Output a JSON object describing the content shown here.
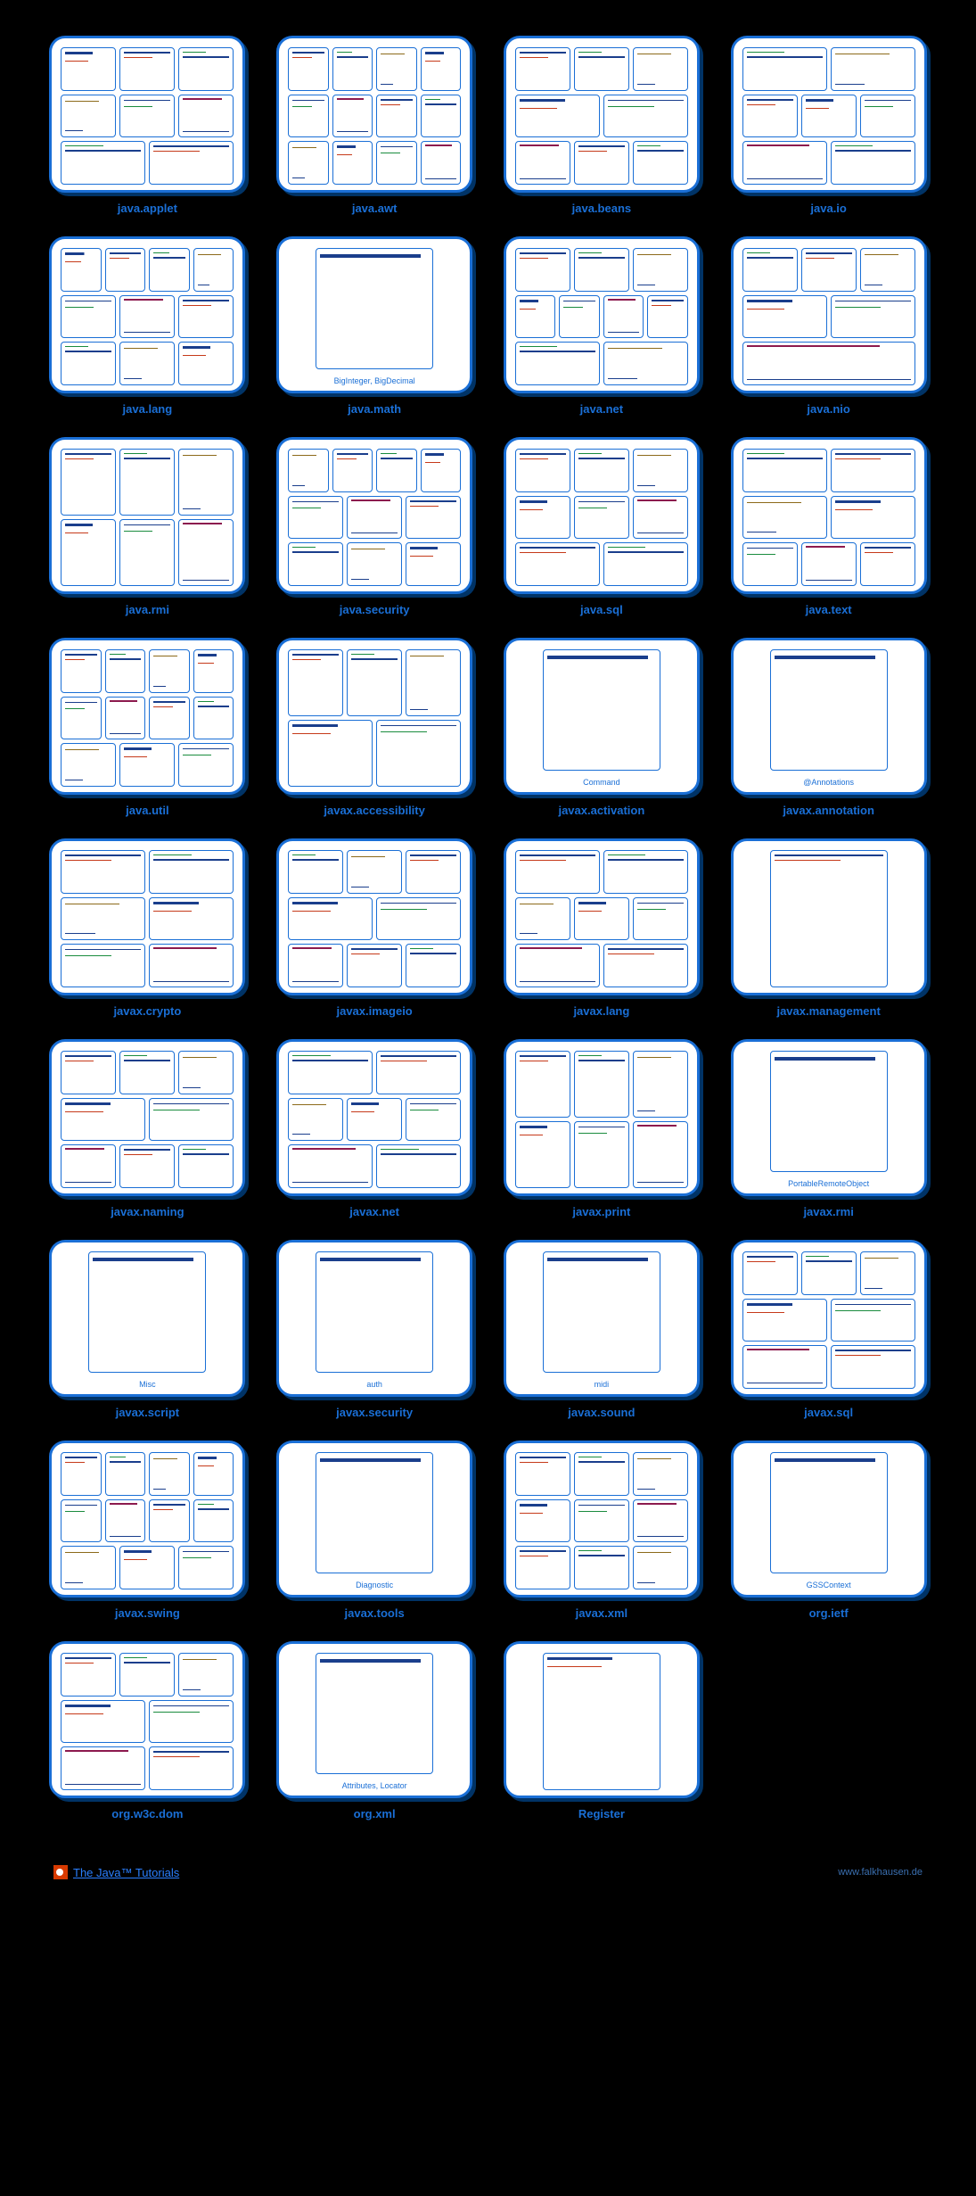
{
  "items": [
    {
      "label": "java.applet",
      "caption": ""
    },
    {
      "label": "java.awt",
      "caption": ""
    },
    {
      "label": "java.beans",
      "caption": ""
    },
    {
      "label": "java.io",
      "caption": ""
    },
    {
      "label": "java.lang",
      "caption": ""
    },
    {
      "label": "java.math",
      "caption": "BigInteger, BigDecimal"
    },
    {
      "label": "java.net",
      "caption": ""
    },
    {
      "label": "java.nio",
      "caption": ""
    },
    {
      "label": "java.rmi",
      "caption": ""
    },
    {
      "label": "java.security",
      "caption": ""
    },
    {
      "label": "java.sql",
      "caption": ""
    },
    {
      "label": "java.text",
      "caption": ""
    },
    {
      "label": "java.util",
      "caption": ""
    },
    {
      "label": "javax.accessibility",
      "caption": ""
    },
    {
      "label": "javax.activation",
      "caption": "Command"
    },
    {
      "label": "javax.annotation",
      "caption": "@Annotations"
    },
    {
      "label": "javax.crypto",
      "caption": ""
    },
    {
      "label": "javax.imageio",
      "caption": ""
    },
    {
      "label": "javax.lang",
      "caption": ""
    },
    {
      "label": "javax.management",
      "caption": ""
    },
    {
      "label": "javax.naming",
      "caption": ""
    },
    {
      "label": "javax.net",
      "caption": ""
    },
    {
      "label": "javax.print",
      "caption": ""
    },
    {
      "label": "javax.rmi",
      "caption": "PortableRemoteObject"
    },
    {
      "label": "javax.script",
      "caption": "Misc"
    },
    {
      "label": "javax.security",
      "caption": "auth"
    },
    {
      "label": "javax.sound",
      "caption": "midi"
    },
    {
      "label": "javax.sql",
      "caption": ""
    },
    {
      "label": "javax.swing",
      "caption": ""
    },
    {
      "label": "javax.tools",
      "caption": "Diagnostic"
    },
    {
      "label": "javax.xml",
      "caption": ""
    },
    {
      "label": "org.ietf",
      "caption": "GSSContext"
    },
    {
      "label": "org.w3c.dom",
      "caption": ""
    },
    {
      "label": "org.xml",
      "caption": "Attributes, Locator"
    },
    {
      "label": "Register",
      "caption": ""
    }
  ],
  "footer": {
    "tutorials": "The Java™ Tutorials",
    "credit": "www.falkhausen.de"
  },
  "layouts": {
    "variants": [
      [
        [
          "s4",
          "s1",
          "s2"
        ],
        [
          "s3",
          "s5",
          "s6"
        ],
        [
          "s2",
          "s1"
        ]
      ],
      [
        [
          "s1",
          "s2",
          "s3",
          "s4"
        ],
        [
          "s5",
          "s6",
          "s1",
          "s2"
        ],
        [
          "s3",
          "s4",
          "s5",
          "s6"
        ]
      ],
      [
        [
          "s1",
          "s2",
          "s3"
        ],
        [
          "s4",
          "s5"
        ],
        [
          "s6",
          "s1",
          "s2"
        ]
      ],
      [
        [
          "s2",
          "s3"
        ],
        [
          "s1",
          "s4",
          "s5"
        ],
        [
          "s6",
          "s2"
        ]
      ],
      [
        [
          "s4",
          "s1",
          "s2",
          "s3"
        ],
        [
          "s5",
          "s6",
          "s1"
        ],
        [
          "s2",
          "s3",
          "s4"
        ]
      ],
      [
        [
          "s7"
        ]
      ],
      [
        [
          "s1",
          "s2",
          "s3"
        ],
        [
          "s4",
          "s5",
          "s6",
          "s1"
        ],
        [
          "s2",
          "s3"
        ]
      ],
      [
        [
          "s2",
          "s1",
          "s3"
        ],
        [
          "s4",
          "s5"
        ],
        [
          "s6"
        ]
      ],
      [
        [
          "s1",
          "s2",
          "s3"
        ],
        [
          "s4",
          "s5",
          "s6"
        ]
      ],
      [
        [
          "s3",
          "s1",
          "s2",
          "s4"
        ],
        [
          "s5",
          "s6",
          "s1"
        ],
        [
          "s2",
          "s3",
          "s4"
        ]
      ],
      [
        [
          "s1",
          "s2",
          "s3"
        ],
        [
          "s4",
          "s5",
          "s6"
        ],
        [
          "s1",
          "s2"
        ]
      ],
      [
        [
          "s2",
          "s1"
        ],
        [
          "s3",
          "s4"
        ],
        [
          "s5",
          "s6",
          "s1"
        ]
      ],
      [
        [
          "s1",
          "s2",
          "s3",
          "s4"
        ],
        [
          "s5",
          "s6",
          "s1",
          "s2"
        ],
        [
          "s3",
          "s4",
          "s5"
        ]
      ],
      [
        [
          "s1",
          "s2",
          "s3"
        ],
        [
          "s4",
          "s5"
        ]
      ],
      [
        [
          "s7"
        ]
      ],
      [
        [
          "s7"
        ]
      ],
      [
        [
          "s1",
          "s2"
        ],
        [
          "s3",
          "s4"
        ],
        [
          "s5",
          "s6"
        ]
      ],
      [
        [
          "s2",
          "s3",
          "s1"
        ],
        [
          "s4",
          "s5"
        ],
        [
          "s6",
          "s1",
          "s2"
        ]
      ],
      [
        [
          "s1",
          "s2"
        ],
        [
          "s3",
          "s4",
          "s5"
        ],
        [
          "s6",
          "s1"
        ]
      ],
      [
        [
          "s1"
        ]
      ],
      [
        [
          "s1",
          "s2",
          "s3"
        ],
        [
          "s4",
          "s5"
        ],
        [
          "s6",
          "s1",
          "s2"
        ]
      ],
      [
        [
          "s2",
          "s1"
        ],
        [
          "s3",
          "s4",
          "s5"
        ],
        [
          "s6",
          "s2"
        ]
      ],
      [
        [
          "s1",
          "s2",
          "s3"
        ],
        [
          "s4",
          "s5",
          "s6"
        ]
      ],
      [
        [
          "s7"
        ]
      ],
      [
        [
          "s7"
        ]
      ],
      [
        [
          "s7"
        ]
      ],
      [
        [
          "s7"
        ]
      ],
      [
        [
          "s1",
          "s2",
          "s3"
        ],
        [
          "s4",
          "s5"
        ],
        [
          "s6",
          "s1"
        ]
      ],
      [
        [
          "s1",
          "s2",
          "s3",
          "s4"
        ],
        [
          "s5",
          "s6",
          "s1",
          "s2"
        ],
        [
          "s3",
          "s4",
          "s5"
        ]
      ],
      [
        [
          "s7"
        ]
      ],
      [
        [
          "s1",
          "s2",
          "s3"
        ],
        [
          "s4",
          "s5",
          "s6"
        ],
        [
          "s1",
          "s2",
          "s3"
        ]
      ],
      [
        [
          "s7"
        ]
      ],
      [
        [
          "s1",
          "s2",
          "s3"
        ],
        [
          "s4",
          "s5"
        ],
        [
          "s6",
          "s1"
        ]
      ],
      [
        [
          "s7"
        ]
      ],
      [
        [
          "s4"
        ]
      ]
    ]
  }
}
